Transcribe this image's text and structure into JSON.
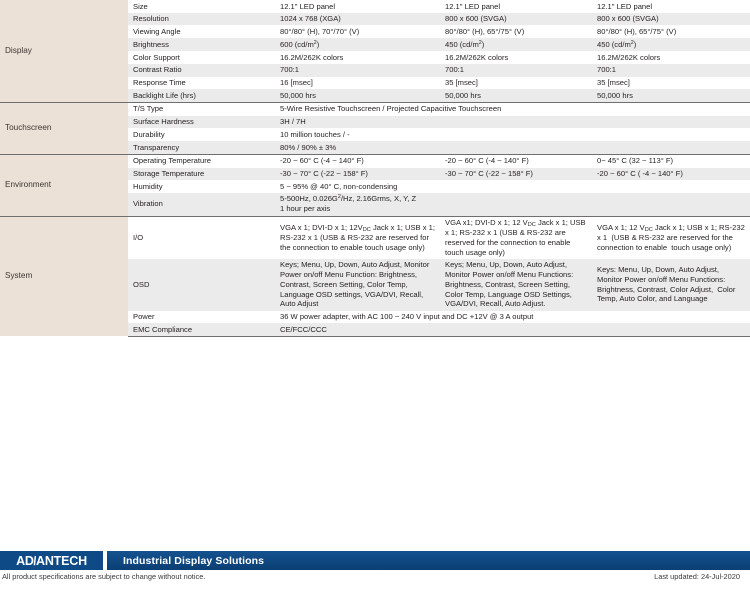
{
  "document": {
    "type": "product-specification-sheet",
    "columns_count": 3
  },
  "table": {
    "groups": [
      {
        "category": "Display",
        "rows": [
          {
            "item": "Size",
            "values": [
              "12.1\" LED panel",
              "12.1\" LED panel",
              "12.1\" LED panel"
            ]
          },
          {
            "item": "Resolution",
            "values": [
              "1024 x 768 (XGA)",
              "800 x 600 (SVGA)",
              "800 x 600 (SVGA)"
            ]
          },
          {
            "item": "Viewing Angle",
            "values": [
              "80°/80° (H), 70°/70° (V)",
              "80°/80° (H), 65°/75° (V)",
              "80°/80° (H), 65°/75° (V)"
            ]
          },
          {
            "item": "Brightness",
            "values": [
              "600 (cd/m2)",
              "450 (cd/m2)",
              "450 (cd/m2)"
            ]
          },
          {
            "item": "Color Support",
            "values": [
              "16.2M/262K colors",
              "16.2M/262K colors",
              "16.2M/262K colors"
            ]
          },
          {
            "item": "Contrast Ratio",
            "values": [
              "700:1",
              "700:1",
              "700:1"
            ]
          },
          {
            "item": "Response Time",
            "values": [
              "16 [msec]",
              "35 [msec]",
              "35 [msec]"
            ]
          },
          {
            "item": "Backlight Life (hrs)",
            "values": [
              "50,000 hrs",
              "50,000 hrs",
              "50,000 hrs"
            ]
          }
        ]
      },
      {
        "category": "Touchscreen",
        "rows": [
          {
            "item": "T/S Type",
            "span": "5-Wire Resistive Touchscreen / Projected Capacitive Touchscreen"
          },
          {
            "item": "Surface Hardness",
            "span": "3H / 7H"
          },
          {
            "item": "Durability",
            "span": "10 million touches / -"
          },
          {
            "item": "Transparency",
            "span": "80% / 90% ± 3%"
          }
        ]
      },
      {
        "category": "Environment",
        "rows": [
          {
            "item": "Operating Temperature",
            "values": [
              "-20 ~ 60° C (-4 ~ 140° F)",
              "-20 ~ 60° C (-4 ~ 140° F)",
              "0~ 45° C (32 ~ 113° F)"
            ]
          },
          {
            "item": "Storage Temperature",
            "values": [
              "-30 ~ 70° C (-22 ~ 158° F)",
              "-30 ~ 70° C (-22 ~ 158° F)",
              "-20 ~ 60° C ( -4 ~ 140° F)"
            ]
          },
          {
            "item": "Humidity",
            "span": "5 ~ 95% @ 40° C, non-condensing"
          },
          {
            "item": "Vibration",
            "span": "5-500Hz, 0.026G2/Hz, 2.16Grms, X, Y, Z\n1 hour per axis"
          }
        ]
      },
      {
        "category": "System",
        "rows": [
          {
            "item": "I/O",
            "values": [
              "VGA x 1; DVI-D x 1; 12VDC Jack x 1; USB x 1; RS-232 x 1 (USB & RS-232 are reserved for the connection to enable touch usage only)",
              "VGA x1; DVI-D x 1; 12 VDC Jack x 1; USB x 1; RS-232 x 1 (USB & RS-232 are reserved for the connection to enable touch usage only)",
              "VGA x 1; 12 VDC Jack x 1; USB x 1; RS-232 x 1  (USB & RS-232 are reserved for the connection to enable  touch usage only)"
            ]
          },
          {
            "item": "OSD",
            "values": [
              "Keys; Menu, Up, Down, Auto Adjust, Monitor Power on/off Menu Function: Brightness, Contrast, Screen Setting, Color Temp, Language OSD settings, VGA/DVI, Recall, Auto Adjust",
              "Keys; Menu, Up, Down, Auto Adjust, Monitor Power on/off Menu Functions: Brightness, Contrast, Screen Setting, Color Temp, Language OSD Settings, VGA/DVI, Recall, Auto Adjust.",
              "Keys: Menu, Up, Down, Auto Adjust, Monitor Power on/off Menu Functions: Brightness, Contrast, Color Adjust,  Color Temp, Auto Color, and Language"
            ]
          },
          {
            "item": "Power",
            "span": "36 W power adapter, with AC 100 ~ 240 V input and DC +12V @ 3 A output"
          },
          {
            "item": "EMC Compliance",
            "span": "CE/FCC/CCC"
          }
        ]
      }
    ]
  },
  "footer": {
    "logo_text": "ADVANTECH",
    "tagline": "Industrial Display Solutions",
    "disclaimer": "All product specifications are subject to change without notice.",
    "last_updated": "Last updated: 24-Jul-2020",
    "brand_color": "#0d4a86",
    "beige_color": "#ece1d7",
    "stripe_color": "#ebebeb"
  }
}
